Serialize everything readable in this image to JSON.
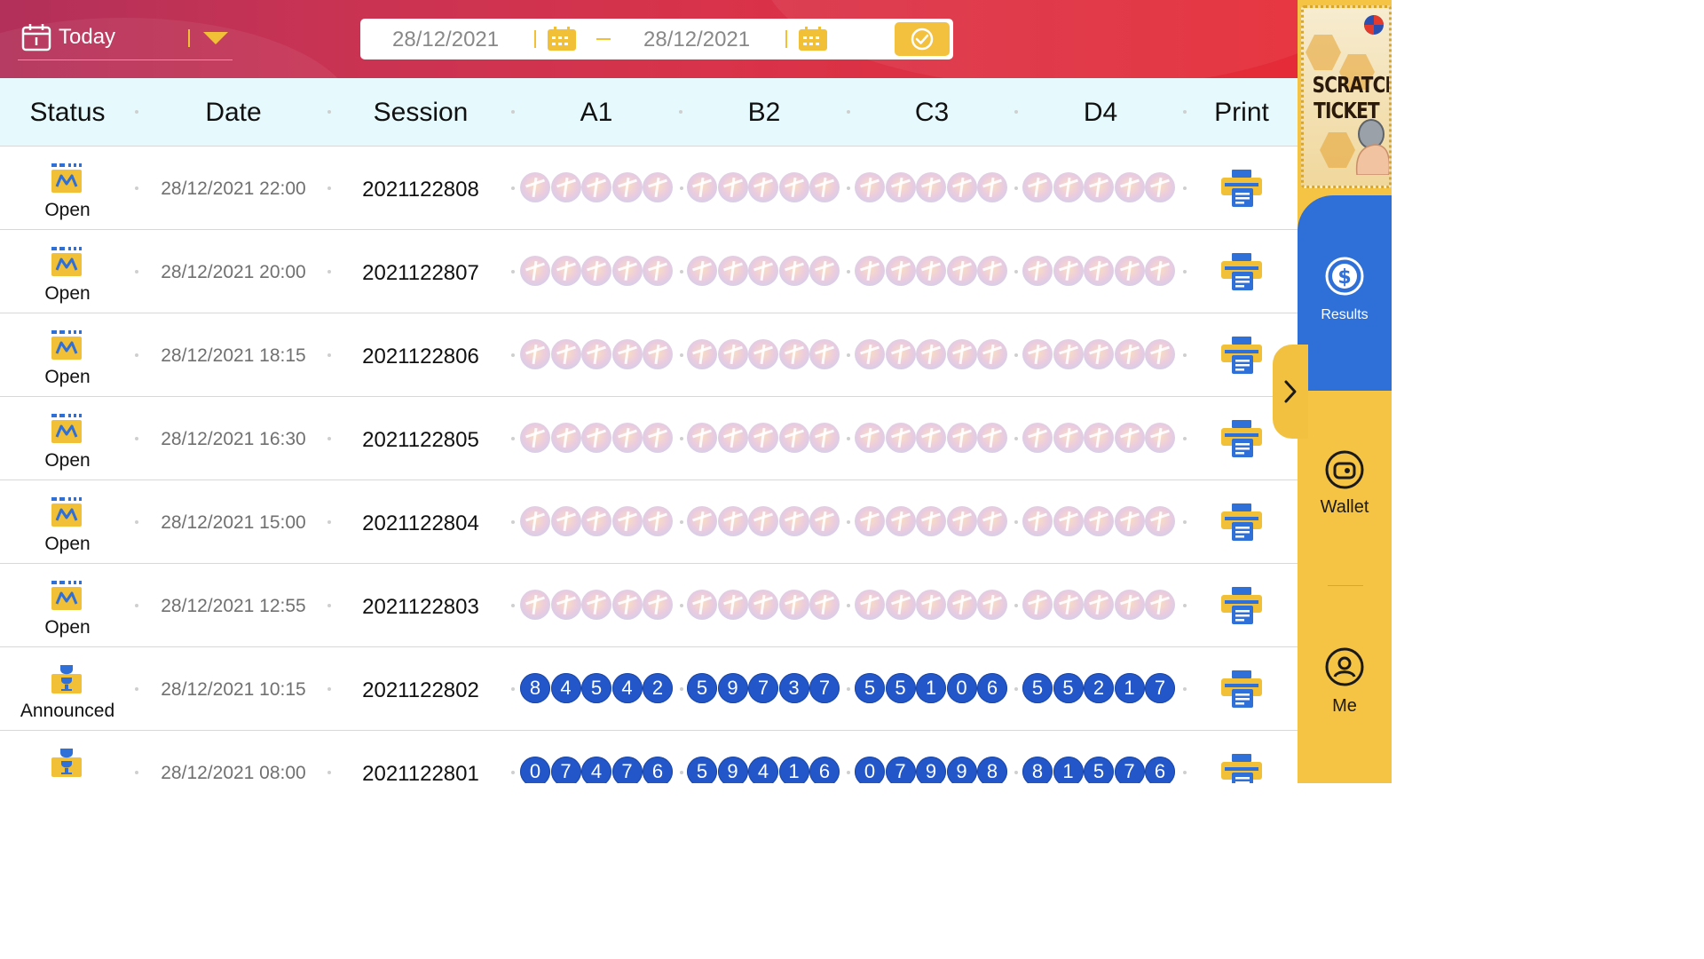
{
  "header": {
    "period_label": "Today",
    "date_from": "28/12/2021",
    "date_to": "28/12/2021"
  },
  "table": {
    "columns": [
      "Status",
      "Date",
      "Session",
      "A1",
      "B2",
      "C3",
      "D4",
      "Print"
    ],
    "rows": [
      {
        "status": "Open",
        "date": "28/12/2021 22:00",
        "session": "2021122808",
        "A1": null,
        "B2": null,
        "C3": null,
        "D4": null
      },
      {
        "status": "Open",
        "date": "28/12/2021 20:00",
        "session": "2021122807",
        "A1": null,
        "B2": null,
        "C3": null,
        "D4": null
      },
      {
        "status": "Open",
        "date": "28/12/2021 18:15",
        "session": "2021122806",
        "A1": null,
        "B2": null,
        "C3": null,
        "D4": null
      },
      {
        "status": "Open",
        "date": "28/12/2021 16:30",
        "session": "2021122805",
        "A1": null,
        "B2": null,
        "C3": null,
        "D4": null
      },
      {
        "status": "Open",
        "date": "28/12/2021 15:00",
        "session": "2021122804",
        "A1": null,
        "B2": null,
        "C3": null,
        "D4": null
      },
      {
        "status": "Open",
        "date": "28/12/2021 12:55",
        "session": "2021122803",
        "A1": null,
        "B2": null,
        "C3": null,
        "D4": null
      },
      {
        "status": "Announced",
        "date": "28/12/2021 10:15",
        "session": "2021122802",
        "A1": [
          "8",
          "4",
          "5",
          "4",
          "2"
        ],
        "B2": [
          "5",
          "9",
          "7",
          "3",
          "7"
        ],
        "C3": [
          "5",
          "5",
          "1",
          "0",
          "6"
        ],
        "D4": [
          "5",
          "5",
          "2",
          "1",
          "7"
        ]
      },
      {
        "status": "",
        "date": "28/12/2021 08:00",
        "session": "2021122801",
        "A1": [
          "0",
          "7",
          "4",
          "7",
          "6"
        ],
        "B2": [
          "5",
          "9",
          "4",
          "1",
          "6"
        ],
        "C3": [
          "0",
          "7",
          "9",
          "9",
          "8"
        ],
        "D4": [
          "8",
          "1",
          "5",
          "7",
          "6"
        ]
      }
    ]
  },
  "sidebar": {
    "promo_text": "SCRATCH TICKET",
    "nav": [
      {
        "label": "Results",
        "icon": "dollar-coin-icon",
        "active": true
      },
      {
        "label": "Wallet",
        "icon": "wallet-icon",
        "active": false
      },
      {
        "label": "Me",
        "icon": "user-icon",
        "active": false
      }
    ]
  },
  "colors": {
    "header_start": "#b2305a",
    "header_end": "#e52b37",
    "accent": "#f3c13d",
    "ball_blue": "#2256c9",
    "nav_active": "#2f6fd8",
    "table_head_bg": "#e6fafd"
  }
}
